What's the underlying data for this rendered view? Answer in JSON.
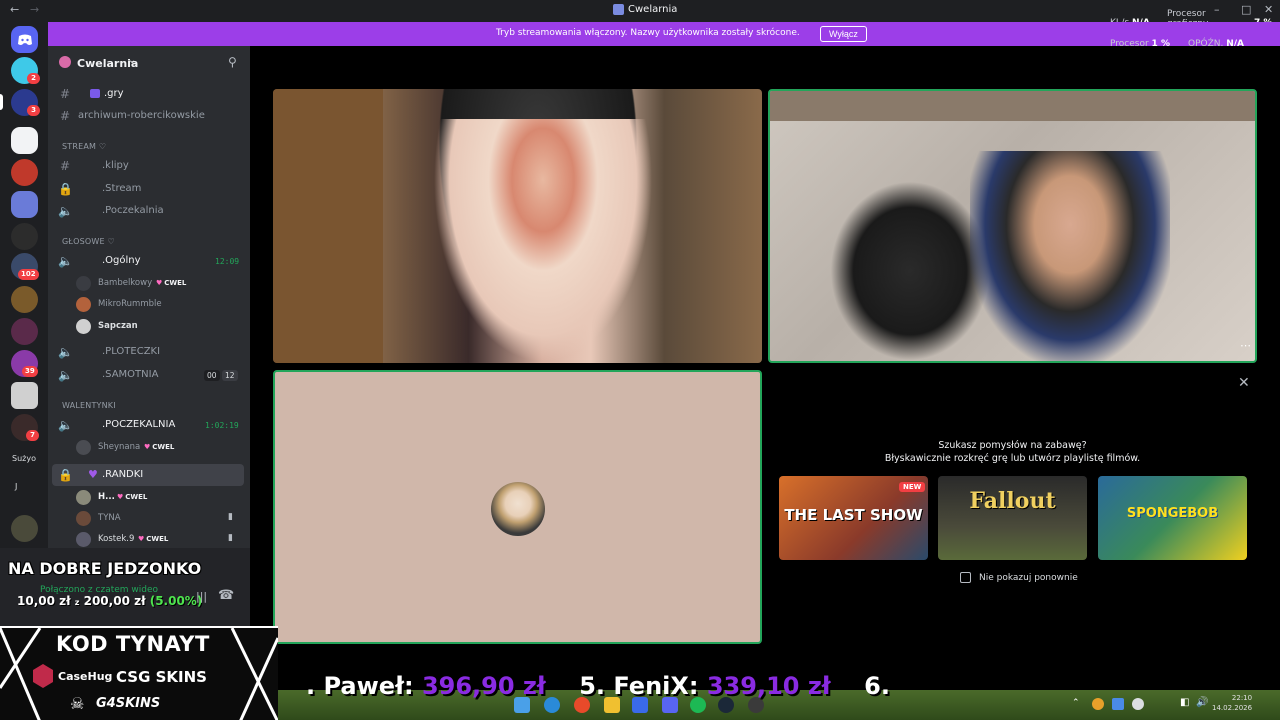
{
  "window": {
    "title": "Cwelarnia",
    "stats": {
      "kbs_label": "KI./s",
      "kbs_value": "N/A",
      "gpu_label": "Procesor graficzny",
      "gpu_value": "7 %",
      "cpu_label": "Procesor",
      "cpu_value": "1 %",
      "delay_label": "OPÓŹN.",
      "delay_value": "N/A"
    }
  },
  "banner": {
    "text": "Tryb streamowania włączony. Nazwy użytkownika zostały skrócone.",
    "button": "Wyłącz"
  },
  "rail": {
    "badges": [
      "2",
      "3",
      "102",
      "39",
      "7"
    ],
    "labels": [
      "Sużyo",
      "J"
    ]
  },
  "server": {
    "name": "Cwelarnia",
    "channels_top": [
      {
        "name": ".gry",
        "icon": "hash-icon"
      },
      {
        "name": "archiwum-robercikowskie",
        "icon": "hash-icon"
      }
    ],
    "categories": {
      "stream": "STREAM ♡",
      "glosowe": "GŁOSOWE ♡",
      "walentynki": "WALENTYNKI"
    },
    "stream_channels": [
      ".klipy",
      ".Stream",
      ".Poczekalnia"
    ],
    "ogolny": {
      "name": ".Ogólny",
      "timer": "12:09"
    },
    "ogolny_users": [
      "Bambelkowy",
      "MikroRummble",
      "Sapczan"
    ],
    "ploteczki": ".PLOTECZKI",
    "samotnia": {
      "name": ".SAMOTNIA",
      "count_a": "00",
      "count_b": "12"
    },
    "poczekalnia": {
      "name": ".POCZEKALNIA",
      "timer": "1:02:19"
    },
    "poczekalnia_users": [
      "Sheynana"
    ],
    "randki": ".RANDKI",
    "randki_users": [
      "H...",
      "TYNA",
      "Kostek.9"
    ],
    "tag": "CWEL"
  },
  "overlay": {
    "food": "NA DOBRE JEDZONKO",
    "voice_status": "Połączono z czatem wideo",
    "donation_current": "10,00 zł",
    "donation_sep": "z",
    "donation_goal": "200,00 zł",
    "donation_pct": "(5.00%)",
    "promo_code": "KOD TYNAYT",
    "brands": [
      "CaseHug",
      "CSG SKINS",
      "G4SKINS"
    ],
    "ticker": {
      "p1_name": ". Paweł:",
      "p1_amount": "396,90 zł",
      "p2_name": "5. FeniX:",
      "p2_amount": "339,10 zł",
      "p3_name": "6."
    }
  },
  "activity": {
    "question": "Szukasz pomysłów na zabawę?",
    "subtitle": "Błyskawicznie rozkręć grę lub utwórz playlistę filmów.",
    "games": [
      {
        "title": "THE LAST SHOW",
        "badge": "NEW"
      },
      {
        "title": "Fallout"
      },
      {
        "title": "SPONGEBOB"
      }
    ],
    "dont_show": "Nie pokazuj ponownie"
  },
  "clock": {
    "time": "22:10",
    "date": "14.02.2026"
  },
  "colors": {
    "accent": "#9c3ee8",
    "speaking": "#23a55a",
    "ticker_amount": "#8a2be2"
  }
}
